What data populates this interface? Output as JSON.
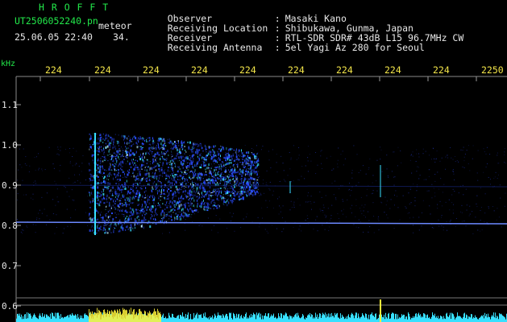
{
  "header": {
    "app_name": "H R O F F T",
    "filename": "UT2506052240.pn",
    "event_type": "meteor",
    "datetime": "25.06.05 22:40",
    "count": "34.",
    "info": [
      {
        "label": "Observer",
        "sep": ":",
        "value": "Masaki Kano"
      },
      {
        "label": "Receiving Location",
        "sep": ":",
        "value": "Shibukawa, Gunma, Japan"
      },
      {
        "label": "Receiver",
        "sep": ":",
        "value": "RTL-SDR SDR# 43dB L15 96.7MHz CW"
      },
      {
        "label": "Receiving Antenna",
        "sep": ":",
        "value": "5el Yagi Az 280 for Seoul"
      }
    ]
  },
  "axes": {
    "y_unit": "kHz",
    "y_ticks": [
      "1.1",
      "1.0",
      "0.9",
      "0.8",
      "0.7",
      "0.6"
    ],
    "x_ticks": [
      "224",
      "224",
      "224",
      "224",
      "224",
      "224",
      "224",
      "224",
      "224",
      "2250"
    ]
  },
  "colors": {
    "background": "#000000",
    "header_green": "#22e84a",
    "tick_yellow": "#f4e64a",
    "signal_blue": "#2a4cff",
    "signal_cyan": "#38e0ff",
    "signal_yellow": "#fff23a",
    "carrier_line": "#6b88ff"
  }
}
